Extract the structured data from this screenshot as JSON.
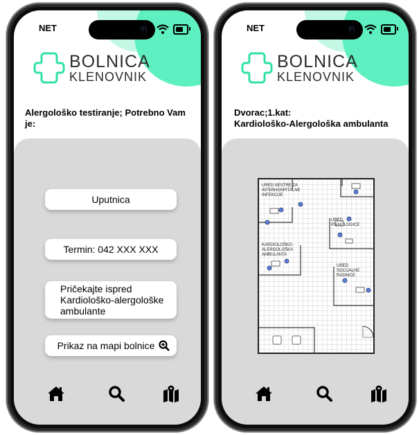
{
  "colors": {
    "accent_teal": "#5ef0c1",
    "accent_pale": "#b9f7e0",
    "panel_gray": "#d9d9d9",
    "logo_stroke": "#2fe0a8"
  },
  "phone_left": {
    "status": {
      "carrier": "NET",
      "icons": [
        "signal-icon",
        "wifi-icon",
        "battery-icon"
      ]
    },
    "logo": {
      "line1": "BOLNICA",
      "line2": "KLENOVNIK"
    },
    "headline": "Alergološko testiranje; Potrebno Vam je:",
    "buttons": {
      "uputnica": "Uputnica",
      "termin": "Termin: 042 XXX XXX",
      "wait": "Pričekajte ispred Kardiološko-alergološke ambulante",
      "map": "Prikaz na mapi bolnice"
    },
    "nav": [
      "home-icon",
      "search-icon",
      "map-icon"
    ]
  },
  "phone_right": {
    "status": {
      "carrier": "NET",
      "icons": [
        "signal-icon",
        "wifi-icon",
        "battery-icon"
      ]
    },
    "logo": {
      "line1": "BOLNICA",
      "line2": "KLENOVNIK"
    },
    "headline_line1": "Dvorac;1.kat:",
    "headline_line2": "Kardiološko-Alergološka ambulanta",
    "floorplan": {
      "rooms": [
        "URED SESTRE ZA INTERHOSPITALNE INFEKCIJE",
        "URED PSIHOLOGICE",
        "KARDIOLOŠKO-ALERGOLOŠKA AMBULANTA",
        "URED SOCIJALNE RADNICE"
      ]
    },
    "nav": [
      "home-icon",
      "search-icon",
      "map-icon"
    ]
  }
}
